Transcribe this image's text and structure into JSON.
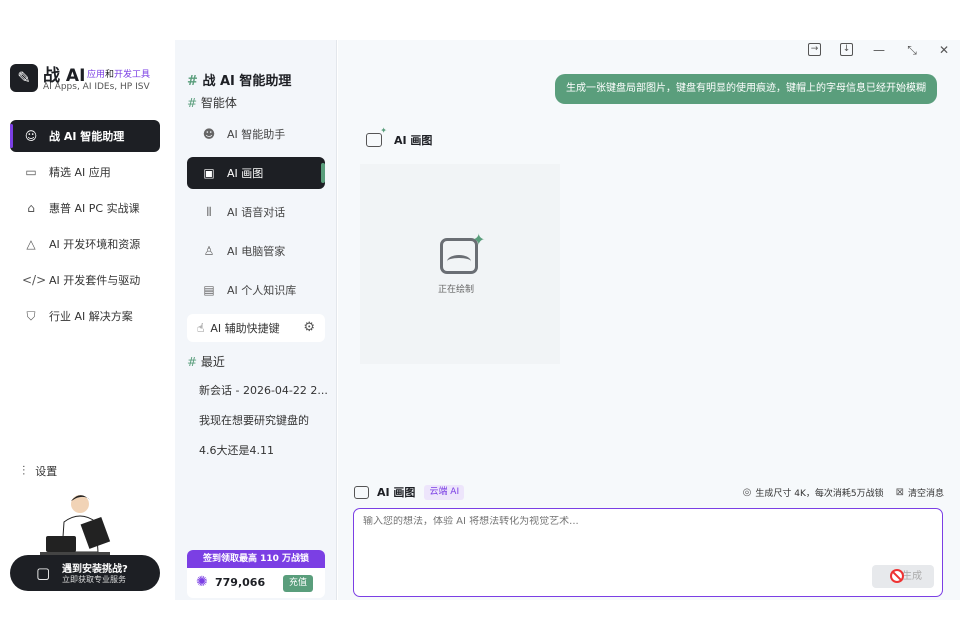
{
  "brand": {
    "name": "战 AI",
    "tag_a": "应用",
    "tag_and": "和",
    "tag_b": "开发工具",
    "subtitle": "AI Apps, AI IDEs, HP ISV",
    "accent": "#7b3fe4",
    "green": "#5a9e7c"
  },
  "nav": {
    "items": [
      {
        "label": "战 AI 智能助理",
        "icon": "smile-box-icon"
      },
      {
        "label": "精选 AI 应用",
        "icon": "terminal-icon"
      },
      {
        "label": "惠普 AI PC 实战课",
        "icon": "graduation-cap-icon"
      },
      {
        "label": "AI 开发环境和资源",
        "icon": "triangle-icon"
      },
      {
        "label": "AI 开发套件与驱动",
        "icon": "code-icon"
      },
      {
        "label": "行业 AI 解决方案",
        "icon": "shield-icon"
      }
    ],
    "settings": "设置"
  },
  "promo": {
    "line1": "遇到安装挑战?",
    "line2": "立即获取专业服务"
  },
  "panel": {
    "title_hash": "#",
    "title": "战 AI 智能助理",
    "agents_header": "智能体",
    "agents": [
      {
        "label": "AI 智能助手",
        "icon": "face-icon"
      },
      {
        "label": "AI 画图",
        "icon": "image-icon"
      },
      {
        "label": "AI 语音对话",
        "icon": "waveform-icon"
      },
      {
        "label": "AI 电脑管家",
        "icon": "user-gear-icon"
      },
      {
        "label": "AI 个人知识库",
        "icon": "book-icon"
      }
    ],
    "hotkey": "AI 辅助快捷键",
    "recent_header": "最近",
    "recent": [
      "新会话 - 2026-04-22 2...",
      "我现在想要研究键盘的",
      "4.6大还是4.11"
    ],
    "bonus_title": "签到领取最高 110 万战锁",
    "bonus_value": "779,066",
    "recharge": "充值"
  },
  "chat": {
    "user_message": "生成一张键盘局部图片，键盘有明显的使用痕迹，键帽上的字母信息已经开始模糊",
    "bot_name": "AI 画图",
    "drawing_status": "正在绘制"
  },
  "composer": {
    "mode": "AI 画图",
    "cloud_badge": "云端 AI",
    "size_info": "生成尺寸 4K，每次消耗5万战锁",
    "clear": "清空消息",
    "placeholder": "输入您的想法，体验 AI 将想法转化为视觉艺术...",
    "generate": "生成"
  }
}
